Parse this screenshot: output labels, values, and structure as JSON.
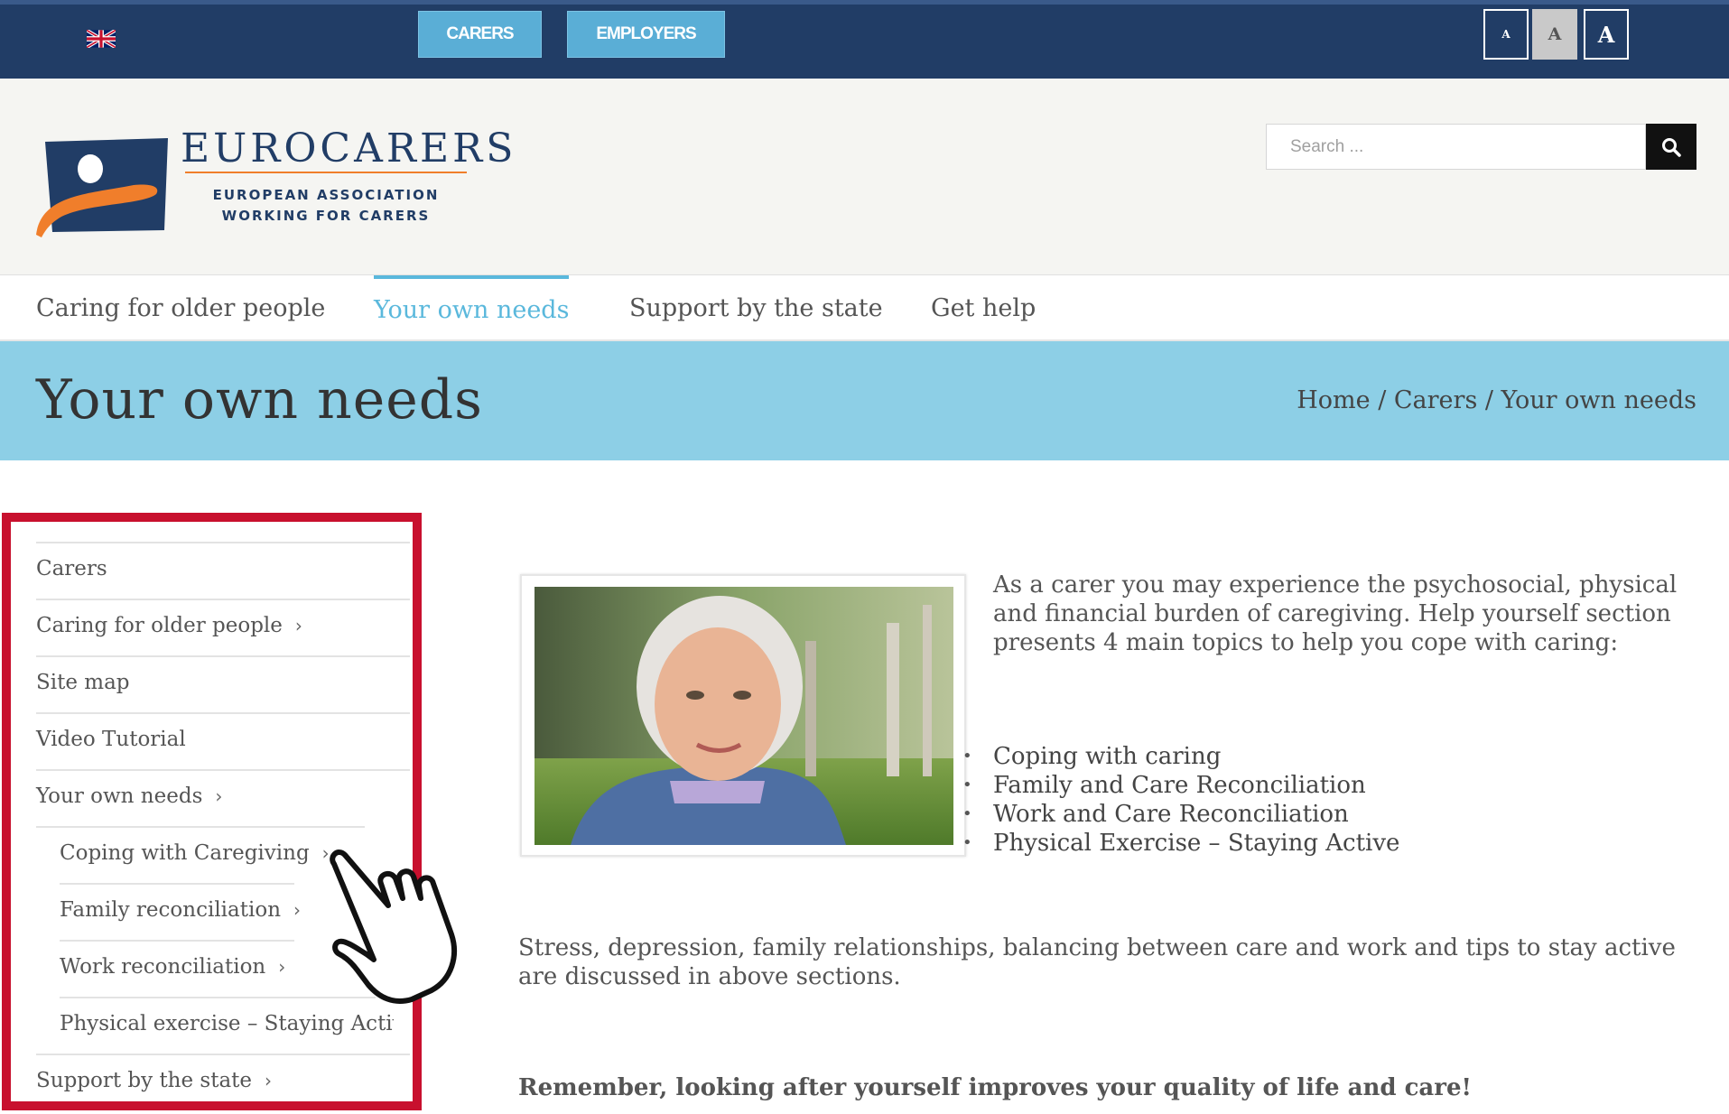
{
  "topbar": {
    "language_icon": "uk-flag-icon",
    "carers_button": "CARERS",
    "employers_button": "EMPLOYERS",
    "font_small": "A",
    "font_medium": "A",
    "font_large": "A"
  },
  "header": {
    "logo_title": "EUROCARERS",
    "logo_subtitle_line1": "EUROPEAN ASSOCIATION",
    "logo_subtitle_line2": "WORKING FOR CARERS",
    "search_placeholder": "Search ...",
    "search_icon": "search-icon"
  },
  "nav": {
    "items": [
      {
        "label": "Caring for older people",
        "active": false
      },
      {
        "label": "Your own needs",
        "active": true
      },
      {
        "label": "Support by the state",
        "active": false
      },
      {
        "label": "Get help",
        "active": false
      }
    ]
  },
  "page": {
    "title": "Your own needs",
    "breadcrumb": "Home / Carers / Your own needs"
  },
  "sidebar": {
    "items": [
      {
        "label": "Carers",
        "has_children": false,
        "level": 0
      },
      {
        "label": "Caring for older people",
        "has_children": true,
        "level": 0
      },
      {
        "label": "Site map",
        "has_children": false,
        "level": 0
      },
      {
        "label": "Video Tutorial",
        "has_children": false,
        "level": 0
      },
      {
        "label": "Your own needs",
        "has_children": true,
        "level": 0
      },
      {
        "label": "Coping with Caregiving",
        "has_children": true,
        "level": 1
      },
      {
        "label": "Family reconciliation",
        "has_children": true,
        "level": 1
      },
      {
        "label": "Work reconciliation",
        "has_children": true,
        "level": 1
      },
      {
        "label": "Physical exercise – Staying Active",
        "has_children": false,
        "level": 1
      },
      {
        "label": "Support by the state",
        "has_children": true,
        "level": 0
      }
    ],
    "chevron": "›"
  },
  "content": {
    "intro": "As a carer you may experience the psychosocial, physical and financial burden of caregiving. Help yourself section presents 4 main topics to help you cope with caring:",
    "topics": [
      "Coping with caring",
      "Family and Care Reconciliation",
      "Work and Care Reconciliation",
      "Physical Exercise – Staying Active"
    ],
    "description": "Stress, depression, family relationships, balancing between care and work and tips to stay active are discussed in above sections.",
    "closing": "Remember, looking after yourself improves your quality of life and care!"
  },
  "colors": {
    "topbar": "#213d66",
    "accent": "#5ab8dc",
    "title_bar": "#8dcfe6",
    "highlight_frame": "#c8102e",
    "logo_orange": "#f07e2b"
  }
}
